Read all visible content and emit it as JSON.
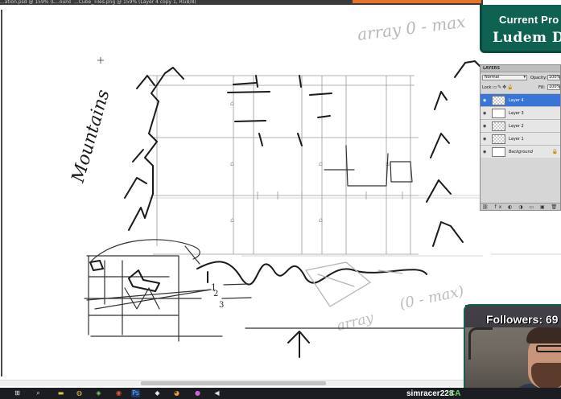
{
  "window": {
    "tabs": [
      {
        "label": "...ation.psd @ 159% (L...ound, RGB/8)"
      },
      {
        "label": "...Cube_Tiles.png @ 159% (Layer 4 copy 1, RGB/8)"
      }
    ]
  },
  "canvas": {
    "handwritten_label": "Mountains",
    "faint_note": "array 0 - max",
    "annotations": [
      "1",
      "2",
      "3"
    ],
    "faint_notes_lower": [
      "(0 - max)",
      "array"
    ]
  },
  "overlay": {
    "brand_line1": "Current Pro",
    "brand_line2": "Ludem D",
    "brand_color": "#0f6151",
    "followers_label": "Followers: 69"
  },
  "layers_panel": {
    "title": "LAYERS",
    "blend_mode": "Normal",
    "opacity_label": "Opacity:",
    "opacity_value": "100%",
    "lock_label": "Lock:",
    "fill_label": "Fill:",
    "fill_value": "100%",
    "selected_color": "#3875d7",
    "layers": [
      {
        "name": "Layer 4",
        "selected": true,
        "thumb": "transparent"
      },
      {
        "name": "Layer 3",
        "selected": false,
        "thumb": "white"
      },
      {
        "name": "Layer 2",
        "selected": false,
        "thumb": "transparent"
      },
      {
        "name": "Layer 1",
        "selected": false,
        "thumb": "transparent"
      },
      {
        "name": "Background",
        "selected": false,
        "thumb": "white",
        "italic": true,
        "locked": true
      }
    ]
  },
  "taskbar": {
    "icons": [
      "windows-start-icon",
      "search-icon",
      "file-explorer-icon",
      "chrome-icon",
      "security-icon",
      "browser-icon",
      "media-icon",
      "photoshop-icon",
      "game-icon",
      "blender-icon",
      "app-icon",
      "media-player-icon"
    ],
    "streamer_name": "simracer223",
    "streamer_suffix": "CA"
  }
}
